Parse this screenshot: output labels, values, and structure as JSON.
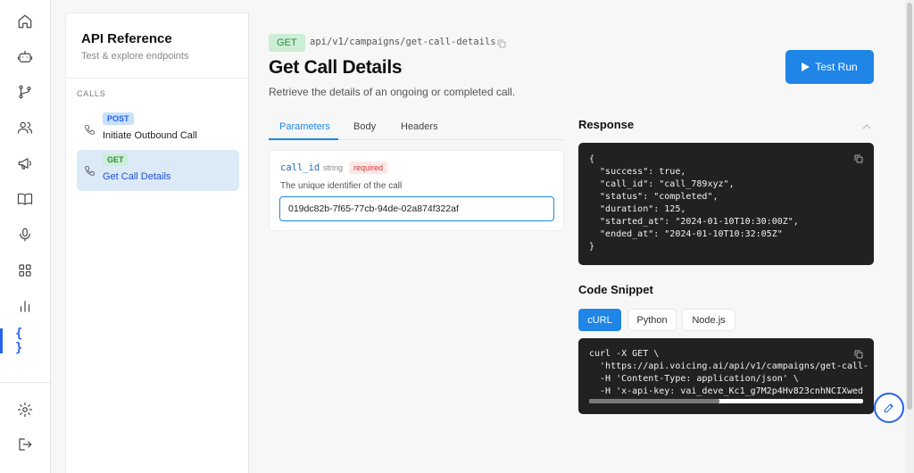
{
  "sidebar": {
    "title": "API Reference",
    "subtitle": "Test & explore endpoints",
    "section": "CALLS",
    "items": [
      {
        "method": "POST",
        "label": "Initiate Outbound Call"
      },
      {
        "method": "GET",
        "label": "Get Call Details"
      }
    ]
  },
  "rail": {
    "icons": [
      "home-icon",
      "bot-icon",
      "branch-icon",
      "users-icon",
      "megaphone-icon",
      "book-icon",
      "mic-icon",
      "grid-icon",
      "bar-chart-icon",
      "code-braces-icon",
      "gear-icon",
      "logout-icon"
    ],
    "braces": "{ }",
    "accent": "#2563eb"
  },
  "endpoint": {
    "method": "GET",
    "path": "api/v1/campaigns/get-call-details",
    "title": "Get Call Details",
    "description": "Retrieve the details of an ongoing or completed call.",
    "test_run_label": "Test Run"
  },
  "tabs": [
    {
      "label": "Parameters",
      "active": true
    },
    {
      "label": "Body",
      "active": false
    },
    {
      "label": "Headers",
      "active": false
    }
  ],
  "param": {
    "name": "call_id",
    "type": "string",
    "required_label": "required",
    "description": "The unique identifier of the call",
    "value": "019dc82b-7f65-77cb-94de-02a874f322af"
  },
  "response": {
    "title": "Response",
    "code": "{\n  \"success\": true,\n  \"call_id\": \"call_789xyz\",\n  \"status\": \"completed\",\n  \"duration\": 125,\n  \"started_at\": \"2024-01-10T10:30:00Z\",\n  \"ended_at\": \"2024-01-10T10:32:05Z\"\n}"
  },
  "snippet": {
    "title": "Code Snippet",
    "languages": [
      {
        "label": "cURL",
        "active": true
      },
      {
        "label": "Python",
        "active": false
      },
      {
        "label": "Node.js",
        "active": false
      }
    ],
    "code": "curl -X GET \\\n  'https://api.voicing.ai/api/v1/campaigns/get-call-\n  -H 'Content-Type: application/json' \\\n  -H 'x-api-key: vai_deve_Kc1_g7M2p4Hv823cnhNCIXwed"
  },
  "colors": {
    "primary": "#1f85e6",
    "get_badge_bg": "#cdeed6",
    "get_badge_fg": "#2b8a3e",
    "post_badge_bg": "#c9e0fb",
    "required_fg": "#d63939",
    "code_bg": "#212121"
  }
}
